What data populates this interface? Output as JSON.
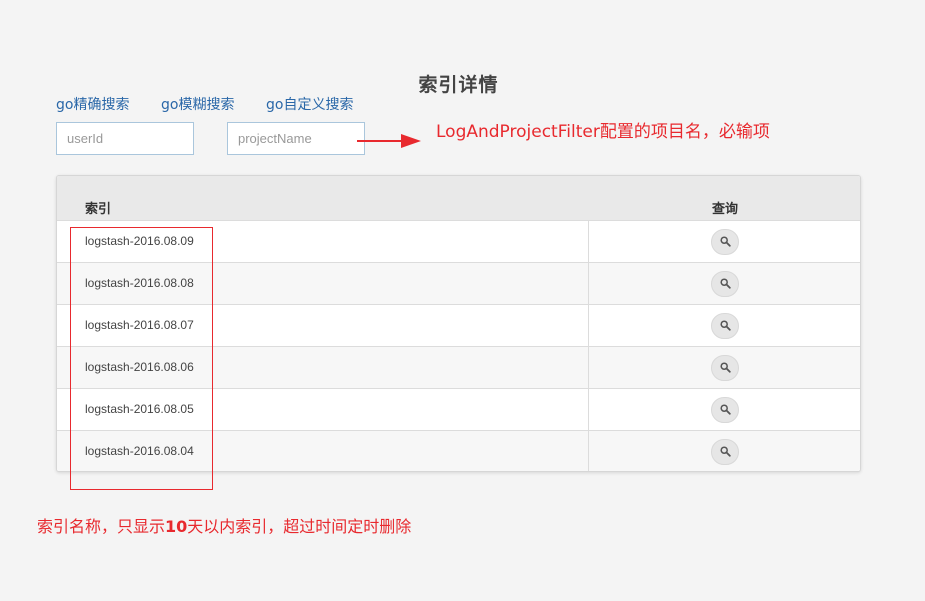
{
  "page": {
    "title": "索引详情"
  },
  "search_links": [
    {
      "label": "go精确搜索"
    },
    {
      "label": "go模糊搜索"
    },
    {
      "label": "go自定义搜索"
    }
  ],
  "inputs": {
    "user_id": {
      "placeholder": "userId",
      "value": ""
    },
    "project_name": {
      "placeholder": "projectName",
      "value": ""
    }
  },
  "annotations": {
    "project_filter_note": "LogAndProjectFilter配置的项目名，必输项",
    "retention_note_prefix": "索引名称，只显示",
    "retention_note_days": "10",
    "retention_note_suffix": "天以内索引，超过时间定时删除"
  },
  "table": {
    "columns": [
      "索引",
      "查询"
    ],
    "rows": [
      {
        "index": "logstash-2016.08.09"
      },
      {
        "index": "logstash-2016.08.08"
      },
      {
        "index": "logstash-2016.08.07"
      },
      {
        "index": "logstash-2016.08.06"
      },
      {
        "index": "logstash-2016.08.05"
      },
      {
        "index": "logstash-2016.08.04"
      }
    ],
    "row_action_icon": "search-icon"
  },
  "colors": {
    "annotation": "#e8292e",
    "link": "#2a67a8",
    "input_border": "#aac6dc"
  }
}
